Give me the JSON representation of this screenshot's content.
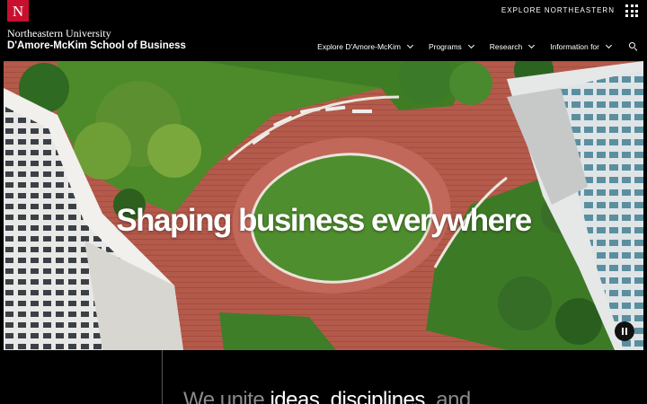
{
  "topbar": {
    "logo_letter": "N",
    "explore_label": "EXPLORE NORTHEASTERN",
    "menu_icon": "grid-icon"
  },
  "brand": {
    "university": "Northeastern University",
    "school": "D'Amore-McKim School of Business"
  },
  "nav": {
    "items": [
      {
        "label": "Explore D'Amore-McKim"
      },
      {
        "label": "Programs"
      },
      {
        "label": "Research"
      },
      {
        "label": "Information for"
      }
    ],
    "search_icon": "search-icon"
  },
  "hero": {
    "title": "Shaping business everywhere",
    "pause_icon": "pause-icon"
  },
  "intro": {
    "part1": "We unite ",
    "part2": "ideas",
    "part3": ", ",
    "part4": "disciplines",
    "part5": ", and"
  },
  "colors": {
    "brand_red": "#c8102e",
    "background": "#000000",
    "brick": "#b5584a",
    "lawn": "#4f8a2c"
  }
}
